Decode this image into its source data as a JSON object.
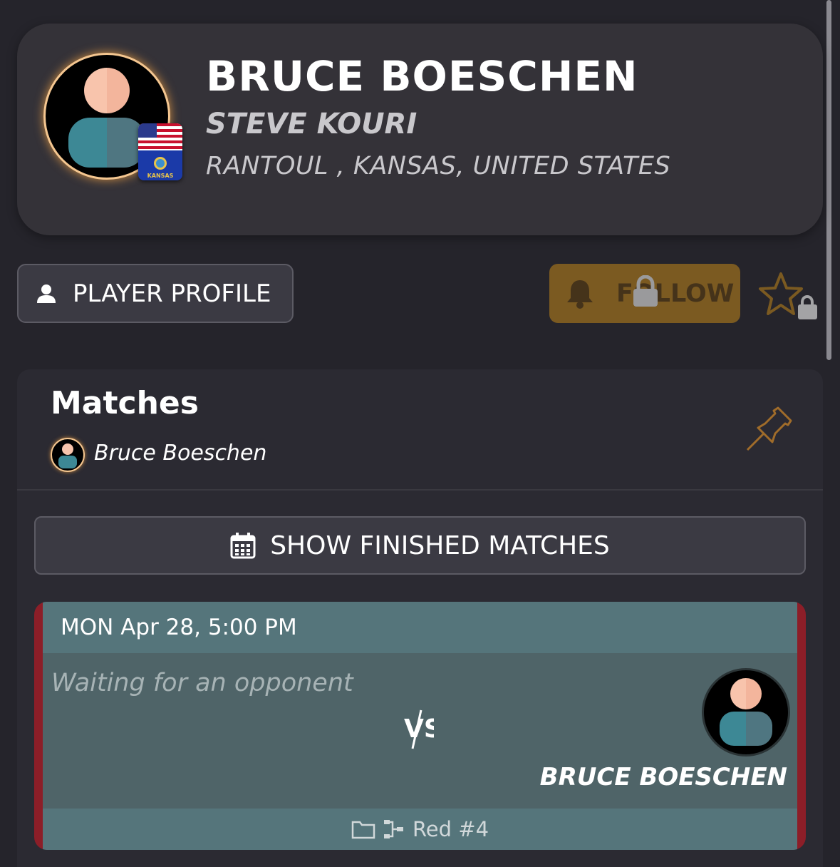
{
  "header": {
    "player_name": "BRUCE BOESCHEN",
    "partner_name": "STEVE KOURI",
    "location": "RANTOUL , KANSAS, UNITED STATES",
    "flag_label": "KANSAS"
  },
  "actions": {
    "profile_label": "PLAYER PROFILE",
    "follow_label": "FOLLOW"
  },
  "matches": {
    "title": "Matches",
    "filter_player": "Bruce Boeschen",
    "show_finished_label": "SHOW FINISHED MATCHES",
    "items": [
      {
        "datetime": "MON Apr 28, 5:00 PM",
        "left_player": "Waiting for an opponent",
        "vs": "VS",
        "right_player": "BRUCE BOESCHEN",
        "table": "Red #4"
      }
    ]
  },
  "colors": {
    "background": "#25242b",
    "accent_gold": "#f4c690",
    "follow_locked": "#7b5a21",
    "match_border": "#8c1e28",
    "match_body": "#4f6468"
  }
}
